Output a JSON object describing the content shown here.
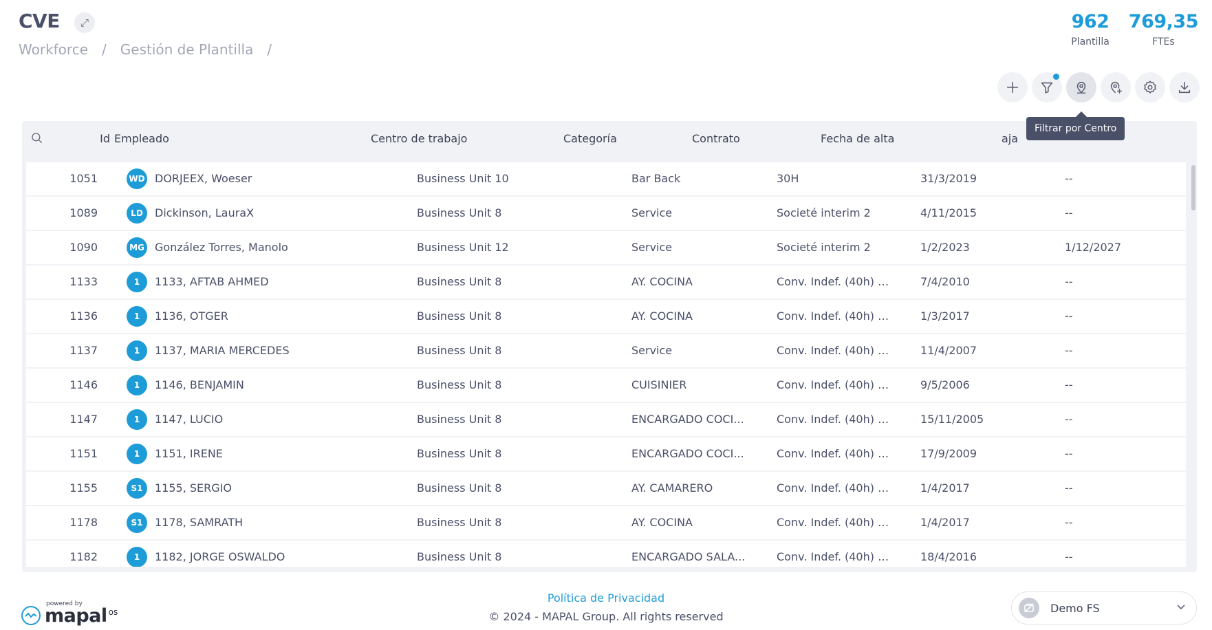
{
  "header": {
    "title": "CVE",
    "breadcrumb": [
      "Workforce",
      "Gestión de Plantilla"
    ],
    "breadcrumb_sep": "/"
  },
  "stats": [
    {
      "value": "962",
      "label": "Plantilla"
    },
    {
      "value": "769,35",
      "label": "FTEs"
    }
  ],
  "toolbar": {
    "buttons": [
      {
        "name": "add-button",
        "icon": "plus-icon"
      },
      {
        "name": "filter-button",
        "icon": "filter-icon",
        "badge": true
      },
      {
        "name": "filter-center-button",
        "icon": "location-icon",
        "active": true
      },
      {
        "name": "add-location-button",
        "icon": "location-plus-icon"
      },
      {
        "name": "settings-button",
        "icon": "gear-icon"
      },
      {
        "name": "download-button",
        "icon": "download-icon"
      }
    ],
    "tooltip": "Filtrar por Centro"
  },
  "table": {
    "columns": {
      "id": "Id",
      "empleado": "Empleado",
      "centro": "Centro de trabajo",
      "categoria": "Categoría",
      "contrato": "Contrato",
      "alta": "Fecha de alta",
      "baja_partial": "aja"
    },
    "rows": [
      {
        "id": "1051",
        "initials": "WD",
        "name": "DORJEEX, Woeser",
        "centro": "Business Unit 10",
        "categoria": "Bar Back",
        "contrato": "30H",
        "alta": "31/3/2019",
        "baja": "--"
      },
      {
        "id": "1089",
        "initials": "LD",
        "name": "Dickinson, LauraX",
        "centro": "Business Unit 8",
        "categoria": "Service",
        "contrato": "Societé interim 2",
        "alta": "4/11/2015",
        "baja": "--"
      },
      {
        "id": "1090",
        "initials": "MG",
        "name": "González Torres, Manolo",
        "centro": "Business Unit 12",
        "categoria": "Service",
        "contrato": "Societé interim 2",
        "alta": "1/2/2023",
        "baja": "1/12/2027"
      },
      {
        "id": "1133",
        "initials": "1",
        "name": "1133, AFTAB AHMED",
        "centro": "Business Unit 8",
        "categoria": "AY. COCINA",
        "contrato": "Conv. Indef. (40h) +...",
        "alta": "7/4/2010",
        "baja": "--"
      },
      {
        "id": "1136",
        "initials": "1",
        "name": "1136, OTGER",
        "centro": "Business Unit 8",
        "categoria": "AY. COCINA",
        "contrato": "Conv. Indef. (40h) +...",
        "alta": "1/3/2017",
        "baja": "--"
      },
      {
        "id": "1137",
        "initials": "1",
        "name": "1137, MARIA MERCEDES",
        "centro": "Business Unit 8",
        "categoria": "Service",
        "contrato": "Conv. Indef. (40h) +...",
        "alta": "11/4/2007",
        "baja": "--"
      },
      {
        "id": "1146",
        "initials": "1",
        "name": "1146, BENJAMIN",
        "centro": "Business Unit 8",
        "categoria": "CUISINIER",
        "contrato": "Conv. Indef. (40h) +...",
        "alta": "9/5/2006",
        "baja": "--"
      },
      {
        "id": "1147",
        "initials": "1",
        "name": "1147, LUCIO",
        "centro": "Business Unit 8",
        "categoria": "ENCARGADO COCI...",
        "contrato": "Conv. Indef. (40h) +...",
        "alta": "15/11/2005",
        "baja": "--"
      },
      {
        "id": "1151",
        "initials": "1",
        "name": "1151, IRENE",
        "centro": "Business Unit 8",
        "categoria": "ENCARGADO COCI...",
        "contrato": "Conv. Indef. (40h) +...",
        "alta": "17/9/2009",
        "baja": "--"
      },
      {
        "id": "1155",
        "initials": "S1",
        "name": "1155, SERGIO",
        "centro": "Business Unit 8",
        "categoria": "AY. CAMARERO",
        "contrato": "Conv. Indef. (40h) +...",
        "alta": "1/4/2017",
        "baja": "--"
      },
      {
        "id": "1178",
        "initials": "S1",
        "name": "1178, SAMRATH",
        "centro": "Business Unit 8",
        "categoria": "AY. COCINA",
        "contrato": "Conv. Indef. (40h) +...",
        "alta": "1/4/2017",
        "baja": "--"
      },
      {
        "id": "1182",
        "initials": "1",
        "name": "1182, JORGE OSWALDO",
        "centro": "Business Unit 8",
        "categoria": "ENCARGADO SALA...",
        "contrato": "Conv. Indef. (40h) +...",
        "alta": "18/4/2016",
        "baja": "--"
      }
    ]
  },
  "footer": {
    "powered_by": "powered by",
    "logo_text": "mapal",
    "logo_suffix": "os",
    "privacy": "Política de Privacidad",
    "copyright": "© 2024 - MAPAL Group. All rights reserved",
    "org_name": "Demo FS"
  },
  "colors": {
    "accent": "#1e9cd7",
    "text": "#3d4256",
    "muted": "#a3a7b5",
    "table_bg": "#f1f2f5"
  }
}
